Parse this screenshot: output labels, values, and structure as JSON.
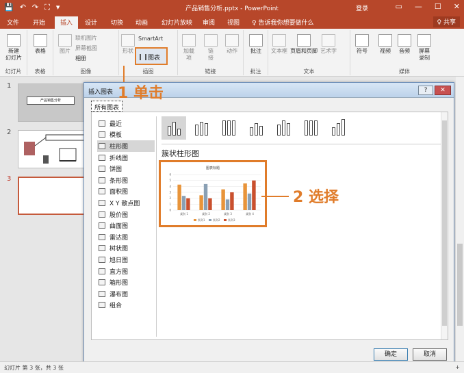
{
  "titlebar": {
    "title": "产品销售分析.pptx - PowerPoint",
    "signin": "登录",
    "qat": [
      "💾",
      "↶",
      "↷",
      "⛶",
      "▾"
    ],
    "win": [
      "▭",
      "—",
      "☐",
      "✕"
    ]
  },
  "tabs": [
    "文件",
    "开始",
    "插入",
    "设计",
    "切换",
    "动画",
    "幻灯片放映",
    "审阅",
    "视图",
    "♀ 告诉我你想要做什么"
  ],
  "share": "♀ 共享",
  "ribbon": {
    "new_slide": "新建\n幻灯片",
    "table": "表格",
    "picture": "图片",
    "online_picture": "联机图片",
    "screenshot": "屏幕截图",
    "album": "相册",
    "shapes": "形状",
    "smartart": "SmartArt",
    "chart": "图表",
    "addin": "加载\n项",
    "link": "链\n接",
    "action": "动作",
    "comment": "批注",
    "textbox": "文本框",
    "header_footer": "页眉和页脚",
    "wordart": "艺术字",
    "symbol": "符号",
    "video": "视频",
    "audio": "音频",
    "screen_rec": "屏幕\n录制",
    "groups": [
      "幻灯片",
      "表格",
      "图像",
      "插图",
      "链接",
      "批注",
      "文本",
      "媒体"
    ]
  },
  "slides": [
    {
      "num": "1",
      "title": "产品销售分析"
    },
    {
      "num": "2"
    },
    {
      "num": "3"
    }
  ],
  "annotations": {
    "step1": "1 单击",
    "step2": "2 选择"
  },
  "dialog": {
    "title": "插入图表",
    "help": "?",
    "close": "✕",
    "tab": "所有图表",
    "categories": [
      "最近",
      "模板",
      "柱形图",
      "折线图",
      "饼图",
      "条形图",
      "面积图",
      "X Y 散点图",
      "股价图",
      "曲面图",
      "雷达图",
      "树状图",
      "旭日图",
      "直方图",
      "箱形图",
      "瀑布图",
      "组合"
    ],
    "active_category": "柱形图",
    "subtype_name": "簇状柱形图",
    "ok": "确定",
    "cancel": "取消"
  },
  "status": {
    "left": "幻灯片 第 3 张，共 3 张",
    "zoom": "+"
  },
  "chart_data": {
    "type": "bar",
    "title": "图表标题",
    "categories": [
      "类别 1",
      "类别 2",
      "类别 3",
      "类别 4"
    ],
    "series": [
      {
        "name": "系列1",
        "values": [
          4.3,
          2.5,
          3.5,
          4.5
        ],
        "color": "#e8943a"
      },
      {
        "name": "系列2",
        "values": [
          2.4,
          4.4,
          1.8,
          2.8
        ],
        "color": "#8aa0b4"
      },
      {
        "name": "系列3",
        "values": [
          2.0,
          2.0,
          3.0,
          5.0
        ],
        "color": "#c9502e"
      }
    ],
    "ylim": [
      0,
      6
    ],
    "yticks": [
      "6",
      "5",
      "4",
      "3",
      "2",
      "1",
      "0"
    ],
    "grid": true,
    "legend": "bottom"
  }
}
